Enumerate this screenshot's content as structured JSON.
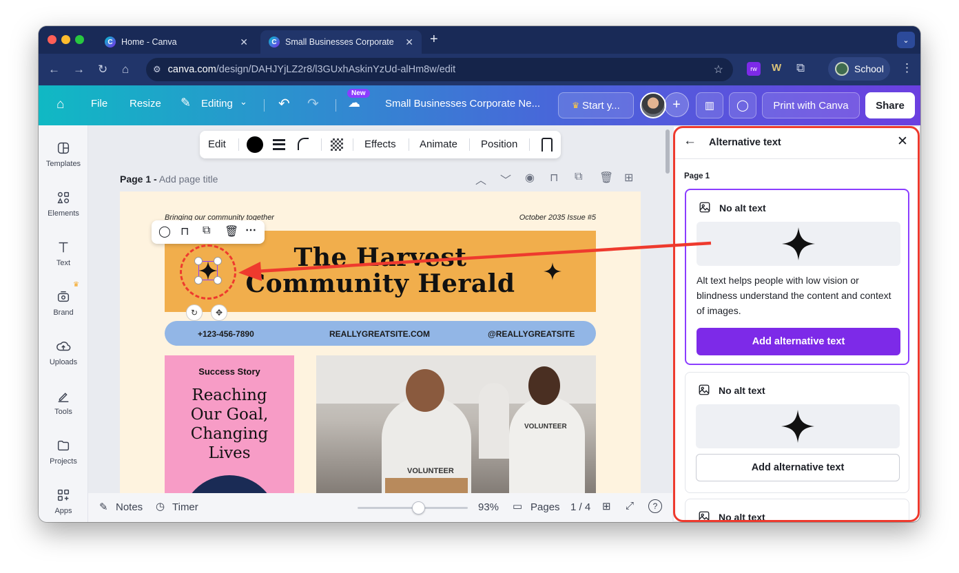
{
  "browser": {
    "tabs": [
      {
        "title": "Home - Canva"
      },
      {
        "title": "Small Businesses Corporate N"
      }
    ],
    "url_host": "canva.com",
    "url_path": "/design/DAHJYjLZ2r8/l3GUxhAskinYzUd-alHm8w/edit",
    "profile": "School"
  },
  "header": {
    "file": "File",
    "resize": "Resize",
    "editing": "Editing",
    "new_badge": "New",
    "doc_title": "Small Businesses Corporate Ne...",
    "start": "Start y...",
    "print": "Print with Canva",
    "share": "Share"
  },
  "sidebar": {
    "items": [
      {
        "label": "Templates",
        "icon": "templates-icon"
      },
      {
        "label": "Elements",
        "icon": "elements-icon"
      },
      {
        "label": "Text",
        "icon": "text-icon"
      },
      {
        "label": "Brand",
        "icon": "brand-icon"
      },
      {
        "label": "Uploads",
        "icon": "uploads-icon"
      },
      {
        "label": "Tools",
        "icon": "tools-icon"
      },
      {
        "label": "Projects",
        "icon": "projects-icon"
      },
      {
        "label": "Apps",
        "icon": "apps-icon"
      }
    ]
  },
  "toolbar": {
    "edit": "Edit",
    "effects": "Effects",
    "animate": "Animate",
    "position": "Position"
  },
  "page": {
    "label": "Page 1 -",
    "title_placeholder": "Add page title"
  },
  "design": {
    "tagline": "Bringing our community together",
    "issue": "October 2035 Issue #5",
    "title_line1": "The Harvest",
    "title_line2": "Community Herald",
    "phone": "+123-456-7890",
    "site": "REALLYGREATSITE.COM",
    "handle": "@REALLYGREATSITE",
    "success_label": "Success Story",
    "headline": "Reaching Our Goal, Changing Lives",
    "shirt1": "VOLUNTEER",
    "shirt2": "VOLUNTEER"
  },
  "bottom": {
    "notes": "Notes",
    "timer": "Timer",
    "zoom": "93%",
    "zoom_fraction": 0.55,
    "pages": "Pages",
    "page_count": "1 / 4"
  },
  "panel": {
    "title": "Alternative text",
    "section": "Page 1",
    "cards": [
      {
        "status": "No alt text",
        "help": "Alt text helps people with low vision or blindness understand the content and context of images.",
        "button": "Add alternative text"
      },
      {
        "status": "No alt text",
        "button": "Add alternative text"
      },
      {
        "status": "No alt text"
      }
    ]
  },
  "colors": {
    "accent": "#7d2ae8",
    "annotation": "#ee3a2e",
    "band": "#f1ae4c",
    "contact": "#92b6e6",
    "pink": "#f79cc6"
  }
}
